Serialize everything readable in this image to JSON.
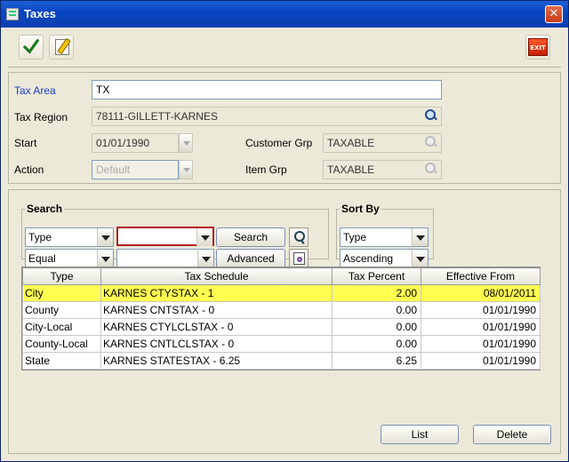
{
  "window": {
    "title": "Taxes"
  },
  "toolbar": {
    "exit_label": "EXIT"
  },
  "header": {
    "tax_area_label": "Tax Area",
    "tax_area_value": "TX",
    "tax_region_label": "Tax Region",
    "tax_region_value": "78111-GILLETT-KARNES",
    "start_label": "Start",
    "start_value": "01/01/1990",
    "customer_grp_label": "Customer Grp",
    "customer_grp_value": "TAXABLE",
    "action_label": "Action",
    "action_value": "Default",
    "item_grp_label": "Item Grp",
    "item_grp_value": "TAXABLE"
  },
  "search": {
    "legend": "Search",
    "field_value": "Type",
    "operator_value": "Equal",
    "criteria_value": "",
    "criteria2_value": "",
    "search_button": "Search",
    "advanced_button": "Advanced"
  },
  "sort": {
    "legend": "Sort By",
    "field_value": "Type",
    "order_value": "Ascending"
  },
  "table": {
    "columns": [
      "Type",
      "Tax Schedule",
      "Tax Percent",
      "Effective From"
    ],
    "rows": [
      {
        "type": "City",
        "schedule": "KARNES CTYSTAX - 1",
        "percent": "2.00",
        "effective": "08/01/2011"
      },
      {
        "type": "County",
        "schedule": "KARNES CNTSTAX - 0",
        "percent": "0.00",
        "effective": "01/01/1990"
      },
      {
        "type": "City-Local",
        "schedule": "KARNES CTYLCLSTAX - 0",
        "percent": "0.00",
        "effective": "01/01/1990"
      },
      {
        "type": "County-Local",
        "schedule": "KARNES CNTLCLSTAX - 0",
        "percent": "0.00",
        "effective": "01/01/1990"
      },
      {
        "type": "State",
        "schedule": "KARNES STATESTAX - 6.25",
        "percent": "6.25",
        "effective": "01/01/1990"
      }
    ]
  },
  "buttons": {
    "list_label": "List",
    "delete_label": "Delete"
  },
  "colors": {
    "selected_row": "#ffff50",
    "title_bar": "#0a46c4"
  }
}
